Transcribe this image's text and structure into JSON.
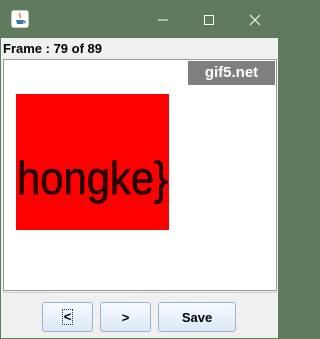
{
  "window": {
    "icon": "java-cup-icon"
  },
  "controls": {
    "minimize_icon": "minimize-icon",
    "maximize_icon": "maximize-icon",
    "close_icon": "close-icon"
  },
  "status": {
    "frame_text": "Frame : 79 of 89"
  },
  "canvas": {
    "watermark": "gif5.net",
    "image_text": "hongke}",
    "image_background": "#ff0000"
  },
  "buttons": {
    "prev_label": "<",
    "next_label": ">",
    "save_label": "Save"
  }
}
